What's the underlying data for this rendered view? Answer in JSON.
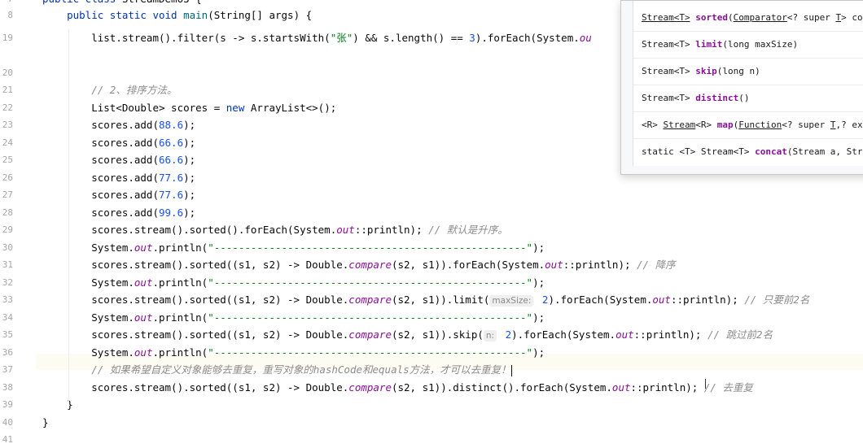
{
  "editor": {
    "line_numbers": [
      "7",
      "8",
      "19",
      "20",
      "21",
      "22",
      "23",
      "24",
      "25",
      "26",
      "27",
      "28",
      "29",
      "30",
      "31",
      "32",
      "33",
      "34",
      "35",
      "36",
      "37",
      "38",
      "39",
      "40",
      "41"
    ],
    "lines": [
      {
        "parts": [
          [
            "kw",
            "public class "
          ],
          [
            "",
            "StreamDemo3 {"
          ]
        ]
      },
      {
        "parts": [
          [
            "",
            "    "
          ],
          [
            "kw",
            "public static void "
          ],
          [
            "method",
            "main"
          ],
          [
            "",
            "(String[] args) {"
          ]
        ]
      },
      {
        "parts": [
          [
            "",
            "        list.stream().filter(s -> s.startsWith("
          ],
          [
            "str",
            "\"张\""
          ],
          [
            "",
            ") && s.length() == "
          ],
          [
            "num",
            "3"
          ],
          [
            "",
            ").forEach(System."
          ],
          [
            "static",
            "ou"
          ]
        ]
      },
      {
        "parts": [
          [
            "",
            ""
          ]
        ]
      },
      {
        "parts": [
          [
            "",
            "        "
          ],
          [
            "cmt",
            "// 2、排序方法。"
          ]
        ]
      },
      {
        "parts": [
          [
            "",
            "        List<Double> scores = "
          ],
          [
            "kw",
            "new "
          ],
          [
            "",
            "ArrayList<>();"
          ]
        ]
      },
      {
        "parts": [
          [
            "",
            "        scores.add("
          ],
          [
            "num",
            "88.6"
          ],
          [
            "",
            ");"
          ]
        ]
      },
      {
        "parts": [
          [
            "",
            "        scores.add("
          ],
          [
            "num",
            "66.6"
          ],
          [
            "",
            ");"
          ]
        ]
      },
      {
        "parts": [
          [
            "",
            "        scores.add("
          ],
          [
            "num",
            "66.6"
          ],
          [
            "",
            ");"
          ]
        ]
      },
      {
        "parts": [
          [
            "",
            "        scores.add("
          ],
          [
            "num",
            "77.6"
          ],
          [
            "",
            ");"
          ]
        ]
      },
      {
        "parts": [
          [
            "",
            "        scores.add("
          ],
          [
            "num",
            "77.6"
          ],
          [
            "",
            ");"
          ]
        ]
      },
      {
        "parts": [
          [
            "",
            "        scores.add("
          ],
          [
            "num",
            "99.6"
          ],
          [
            "",
            ");"
          ]
        ]
      },
      {
        "parts": [
          [
            "",
            "        scores.stream().sorted().forEach(System."
          ],
          [
            "static",
            "out"
          ],
          [
            "",
            "::println); "
          ],
          [
            "cmt",
            "// 默认是升序。"
          ]
        ]
      },
      {
        "parts": [
          [
            "",
            "        System."
          ],
          [
            "static",
            "out"
          ],
          [
            "",
            ".println("
          ],
          [
            "str",
            "\"---------------------------------------------------\""
          ],
          [
            "",
            ");"
          ]
        ]
      },
      {
        "parts": [
          [
            "",
            "        scores.stream().sorted((s1, s2) -> Double."
          ],
          [
            "static",
            "compare"
          ],
          [
            "",
            "(s2, s1)).forEach(System."
          ],
          [
            "static",
            "out"
          ],
          [
            "",
            "::println); "
          ],
          [
            "cmt",
            "// 降序"
          ]
        ]
      },
      {
        "parts": [
          [
            "",
            "        System."
          ],
          [
            "static",
            "out"
          ],
          [
            "",
            ".println("
          ],
          [
            "str",
            "\"---------------------------------------------------\""
          ],
          [
            "",
            ");"
          ]
        ]
      },
      {
        "parts": [
          [
            "",
            "        scores.stream().sorted((s1, s2) -> Double."
          ],
          [
            "static",
            "compare"
          ],
          [
            "",
            "(s2, s1)).limit("
          ],
          [
            "hint",
            "maxSize:"
          ],
          [
            "num",
            " 2"
          ],
          [
            "",
            ").forEach(System."
          ],
          [
            "static",
            "out"
          ],
          [
            "",
            "::println); "
          ],
          [
            "cmt",
            "// 只要前2名"
          ]
        ]
      },
      {
        "parts": [
          [
            "",
            "        System."
          ],
          [
            "static",
            "out"
          ],
          [
            "",
            ".println("
          ],
          [
            "str",
            "\"---------------------------------------------------\""
          ],
          [
            "",
            ");"
          ]
        ]
      },
      {
        "parts": [
          [
            "",
            "        scores.stream().sorted((s1, s2) -> Double."
          ],
          [
            "static",
            "compare"
          ],
          [
            "",
            "(s2, s1)).skip("
          ],
          [
            "hint",
            "n:"
          ],
          [
            "num",
            " 2"
          ],
          [
            "",
            ").forEach(System."
          ],
          [
            "static",
            "out"
          ],
          [
            "",
            "::println); "
          ],
          [
            "cmt",
            "// 跳过前2名"
          ]
        ]
      },
      {
        "parts": [
          [
            "",
            "        System."
          ],
          [
            "static",
            "out"
          ],
          [
            "",
            ".println("
          ],
          [
            "str",
            "\"---------------------------------------------------\""
          ],
          [
            "",
            ");"
          ]
        ]
      },
      {
        "parts": [
          [
            "",
            "        "
          ],
          [
            "cmt",
            "// 如果希望自定义对象能够去重复，重写对象的hashCode和equals方法，才可以去重复！"
          ]
        ]
      },
      {
        "parts": [
          [
            "",
            "        scores.stream().sorted((s1, s2) -> Double."
          ],
          [
            "static",
            "compare"
          ],
          [
            "",
            "(s2, s1)).distinct().forEach(System."
          ],
          [
            "static",
            "out"
          ],
          [
            "",
            "::println); "
          ],
          [
            "cmt",
            "// 去重复"
          ]
        ]
      },
      {
        "parts": [
          [
            "",
            "    }"
          ]
        ]
      },
      {
        "parts": [
          [
            "",
            "}"
          ]
        ]
      },
      {
        "parts": [
          [
            "",
            ""
          ]
        ]
      }
    ]
  },
  "popup": {
    "items": [
      {
        "parts": [
          [
            "pul",
            "Stream<T>"
          ],
          [
            "",
            " "
          ],
          [
            "pbold",
            "sorted"
          ],
          [
            "",
            "("
          ],
          [
            "pul",
            "Comparator"
          ],
          [
            "",
            "<? super "
          ],
          [
            "pul",
            "T"
          ],
          [
            "",
            "> co"
          ]
        ]
      },
      {
        "parts": [
          [
            "",
            "Stream<T> "
          ],
          [
            "pbold",
            "limit"
          ],
          [
            "",
            "(long maxSize)"
          ]
        ]
      },
      {
        "parts": [
          [
            "",
            "Stream<T> "
          ],
          [
            "pbold",
            "skip"
          ],
          [
            "",
            "(long n)"
          ]
        ]
      },
      {
        "parts": [
          [
            "",
            "Stream<T> "
          ],
          [
            "pbold",
            "distinct"
          ],
          [
            "",
            "()"
          ]
        ]
      },
      {
        "parts": [
          [
            "",
            "<R> "
          ],
          [
            "pul",
            "Stream"
          ],
          [
            "",
            "<R> "
          ],
          [
            "pbold",
            "map"
          ],
          [
            "",
            "("
          ],
          [
            "pul",
            "Function"
          ],
          [
            "",
            "<? super "
          ],
          [
            "pul",
            "T"
          ],
          [
            "",
            ",? ex"
          ]
        ]
      },
      {
        "parts": [
          [
            "",
            "static <T> Stream<T> "
          ],
          [
            "pbold",
            "concat"
          ],
          [
            "",
            "(Stream a, Str"
          ]
        ]
      }
    ]
  }
}
